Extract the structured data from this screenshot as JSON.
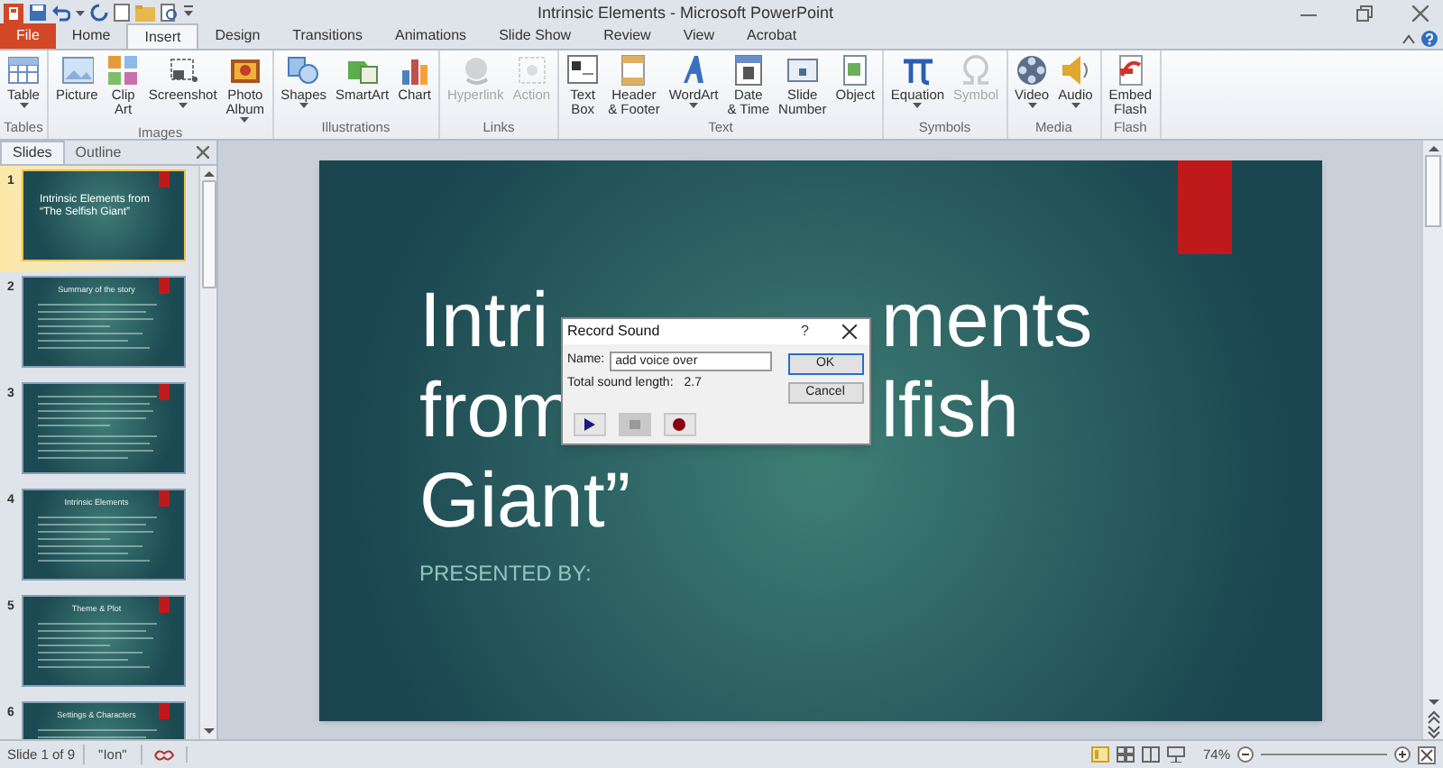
{
  "window": {
    "title": "Intrinsic Elements - Microsoft PowerPoint"
  },
  "tabs": [
    {
      "label": "File",
      "kind": "file",
      "selected": false
    },
    {
      "label": "Home",
      "kind": "tab",
      "selected": false
    },
    {
      "label": "Insert",
      "kind": "tab",
      "selected": true
    },
    {
      "label": "Design",
      "kind": "tab",
      "selected": false
    },
    {
      "label": "Transitions",
      "kind": "tab",
      "selected": false
    },
    {
      "label": "Animations",
      "kind": "tab",
      "selected": false
    },
    {
      "label": "Slide Show",
      "kind": "tab",
      "selected": false
    },
    {
      "label": "Review",
      "kind": "tab",
      "selected": false
    },
    {
      "label": "View",
      "kind": "tab",
      "selected": false
    },
    {
      "label": "Acrobat",
      "kind": "tab",
      "selected": false
    }
  ],
  "ribbon": {
    "groups": [
      {
        "label": "Tables",
        "buttons": [
          {
            "label": "Table",
            "menu": true,
            "disabled": false
          }
        ]
      },
      {
        "label": "Images",
        "buttons": [
          {
            "label": "Picture",
            "menu": false,
            "disabled": false
          },
          {
            "label": "Clip\nArt",
            "menu": false,
            "disabled": false
          },
          {
            "label": "Screenshot",
            "menu": true,
            "disabled": false
          },
          {
            "label": "Photo\nAlbum",
            "menu": true,
            "disabled": false
          }
        ]
      },
      {
        "label": "Illustrations",
        "buttons": [
          {
            "label": "Shapes",
            "menu": true,
            "disabled": false
          },
          {
            "label": "SmartArt",
            "menu": false,
            "disabled": false
          },
          {
            "label": "Chart",
            "menu": false,
            "disabled": false
          }
        ]
      },
      {
        "label": "Links",
        "buttons": [
          {
            "label": "Hyperlink",
            "menu": false,
            "disabled": true
          },
          {
            "label": "Action",
            "menu": false,
            "disabled": true
          }
        ]
      },
      {
        "label": "Text",
        "buttons": [
          {
            "label": "Text\nBox",
            "menu": false,
            "disabled": false
          },
          {
            "label": "Header\n& Footer",
            "menu": false,
            "disabled": false
          },
          {
            "label": "WordArt",
            "menu": true,
            "disabled": false
          },
          {
            "label": "Date\n& Time",
            "menu": false,
            "disabled": false
          },
          {
            "label": "Slide\nNumber",
            "menu": false,
            "disabled": false
          },
          {
            "label": "Object",
            "menu": false,
            "disabled": false
          }
        ]
      },
      {
        "label": "Symbols",
        "buttons": [
          {
            "label": "Equation",
            "menu": true,
            "disabled": false
          },
          {
            "label": "Symbol",
            "menu": false,
            "disabled": true
          }
        ]
      },
      {
        "label": "Media",
        "buttons": [
          {
            "label": "Video",
            "menu": true,
            "disabled": false
          },
          {
            "label": "Audio",
            "menu": true,
            "disabled": false
          }
        ]
      },
      {
        "label": "Flash",
        "buttons": [
          {
            "label": "Embed\nFlash",
            "menu": false,
            "disabled": false
          }
        ]
      }
    ]
  },
  "pane_tabs": [
    {
      "label": "Slides",
      "selected": true
    },
    {
      "label": "Outline",
      "selected": false
    }
  ],
  "thumbnails": [
    {
      "number": "1",
      "kind": "title",
      "title": "Intrinsic  Elements from “The Selfish Giant”",
      "selected": true
    },
    {
      "number": "2",
      "kind": "content",
      "title": "Summary of the story",
      "selected": false
    },
    {
      "number": "3",
      "kind": "text",
      "selected": false
    },
    {
      "number": "4",
      "kind": "content",
      "title": "Intrinsic  Elements",
      "selected": false
    },
    {
      "number": "5",
      "kind": "content",
      "title": "Theme & Plot",
      "selected": false
    },
    {
      "number": "6",
      "kind": "content",
      "title": "Settings & Characters",
      "selected": false
    }
  ],
  "slide": {
    "title_lines": [
      [
        "Intri",
        "ments"
      ],
      [
        "from",
        "lfish"
      ],
      [
        "Giant”"
      ]
    ],
    "subtitle": "PRESENTED BY:"
  },
  "dialog": {
    "title": "Record Sound",
    "help": "?",
    "name_label": "Name:",
    "name_value": "add voice over",
    "length_label": "Total sound length:",
    "length_value": "2.7",
    "buttons": [
      {
        "label": "OK",
        "default": true
      },
      {
        "label": "Cancel",
        "default": false
      }
    ],
    "controls": [
      {
        "kind": "play",
        "disabled": false
      },
      {
        "kind": "stop",
        "disabled": true
      },
      {
        "kind": "record",
        "disabled": false
      }
    ]
  },
  "status_bar": {
    "slide": "Slide 1 of 9",
    "theme": "\"Ion\"",
    "zoom": "74%"
  }
}
